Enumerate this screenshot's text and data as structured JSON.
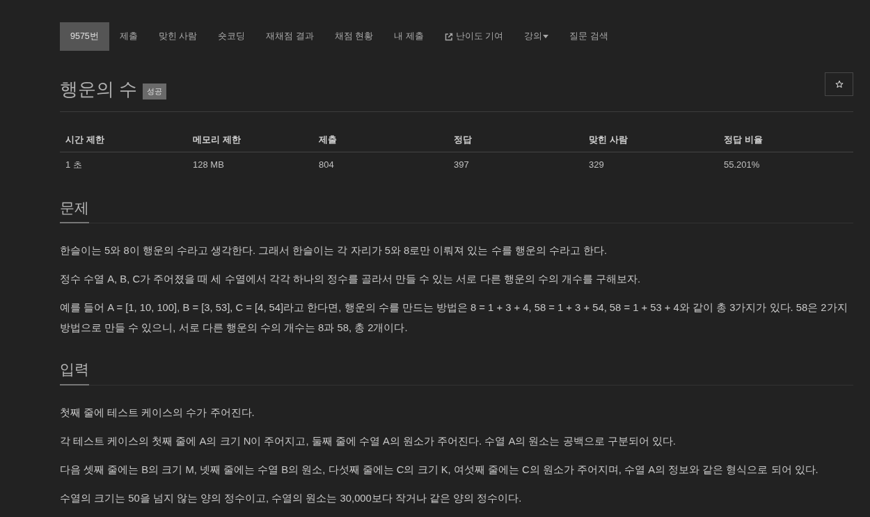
{
  "nav": {
    "items": [
      {
        "label": "9575번",
        "selected": true,
        "kind": "link"
      },
      {
        "label": "제출",
        "selected": false,
        "kind": "link"
      },
      {
        "label": "맞힌 사람",
        "selected": false,
        "kind": "link"
      },
      {
        "label": "숏코딩",
        "selected": false,
        "kind": "link"
      },
      {
        "label": "재채점 결과",
        "selected": false,
        "kind": "link"
      },
      {
        "label": "채점 현황",
        "selected": false,
        "kind": "link"
      },
      {
        "label": "내 제출",
        "selected": false,
        "kind": "link"
      },
      {
        "label": "난이도 기여",
        "selected": false,
        "kind": "external"
      },
      {
        "label": "강의",
        "selected": false,
        "kind": "dropdown"
      },
      {
        "label": "질문 검색",
        "selected": false,
        "kind": "link"
      }
    ]
  },
  "problem": {
    "title": "행운의 수",
    "badge": "성공"
  },
  "info_table": {
    "columns": [
      "시간 제한",
      "메모리 제한",
      "제출",
      "정답",
      "맞힌 사람",
      "정답 비율"
    ],
    "rows": [
      [
        "1 초",
        "128 MB",
        "804",
        "397",
        "329",
        "55.201%"
      ]
    ]
  },
  "sections": [
    {
      "heading": "문제",
      "paragraphs": [
        "한슬이는 5와 8이 행운의 수라고 생각한다. 그래서 한슬이는 각 자리가 5와 8로만 이뤄져 있는 수를 행운의 수라고 한다.",
        "정수 수열 A, B, C가 주어졌을 때 세 수열에서 각각 하나의 정수를 골라서 만들 수 있는 서로 다른 행운의 수의 개수를 구해보자.",
        "예를 들어 A = [1, 10, 100], B = [3, 53], C = [4, 54]라고 한다면, 행운의 수를 만드는 방법은 8 = 1 + 3 + 4, 58 = 1 + 3 + 54, 58 = 1 + 53 + 4와 같이 총 3가지가 있다. 58은 2가지 방법으로 만들 수 있으니, 서로 다른 행운의 수의 개수는 8과 58, 총 2개이다."
      ]
    },
    {
      "heading": "입력",
      "paragraphs": [
        "첫째 줄에 테스트 케이스의 수가 주어진다.",
        "각 테스트 케이스의 첫째 줄에 A의 크기 N이 주어지고, 둘째 줄에 수열 A의 원소가 주어진다. 수열 A의 원소는 공백으로 구분되어 있다.",
        "다음 셋째 줄에는 B의 크기 M, 넷째 줄에는 수열 B의 원소, 다섯째 줄에는 C의 크기 K, 여섯째 줄에는 C의 원소가 주어지며, 수열 A의 정보와 같은 형식으로 되어 있다.",
        "수열의 크기는 50을 넘지 않는 양의 정수이고, 수열의 원소는 30,000보다 작거나 같은 양의 정수이다."
      ]
    }
  ]
}
